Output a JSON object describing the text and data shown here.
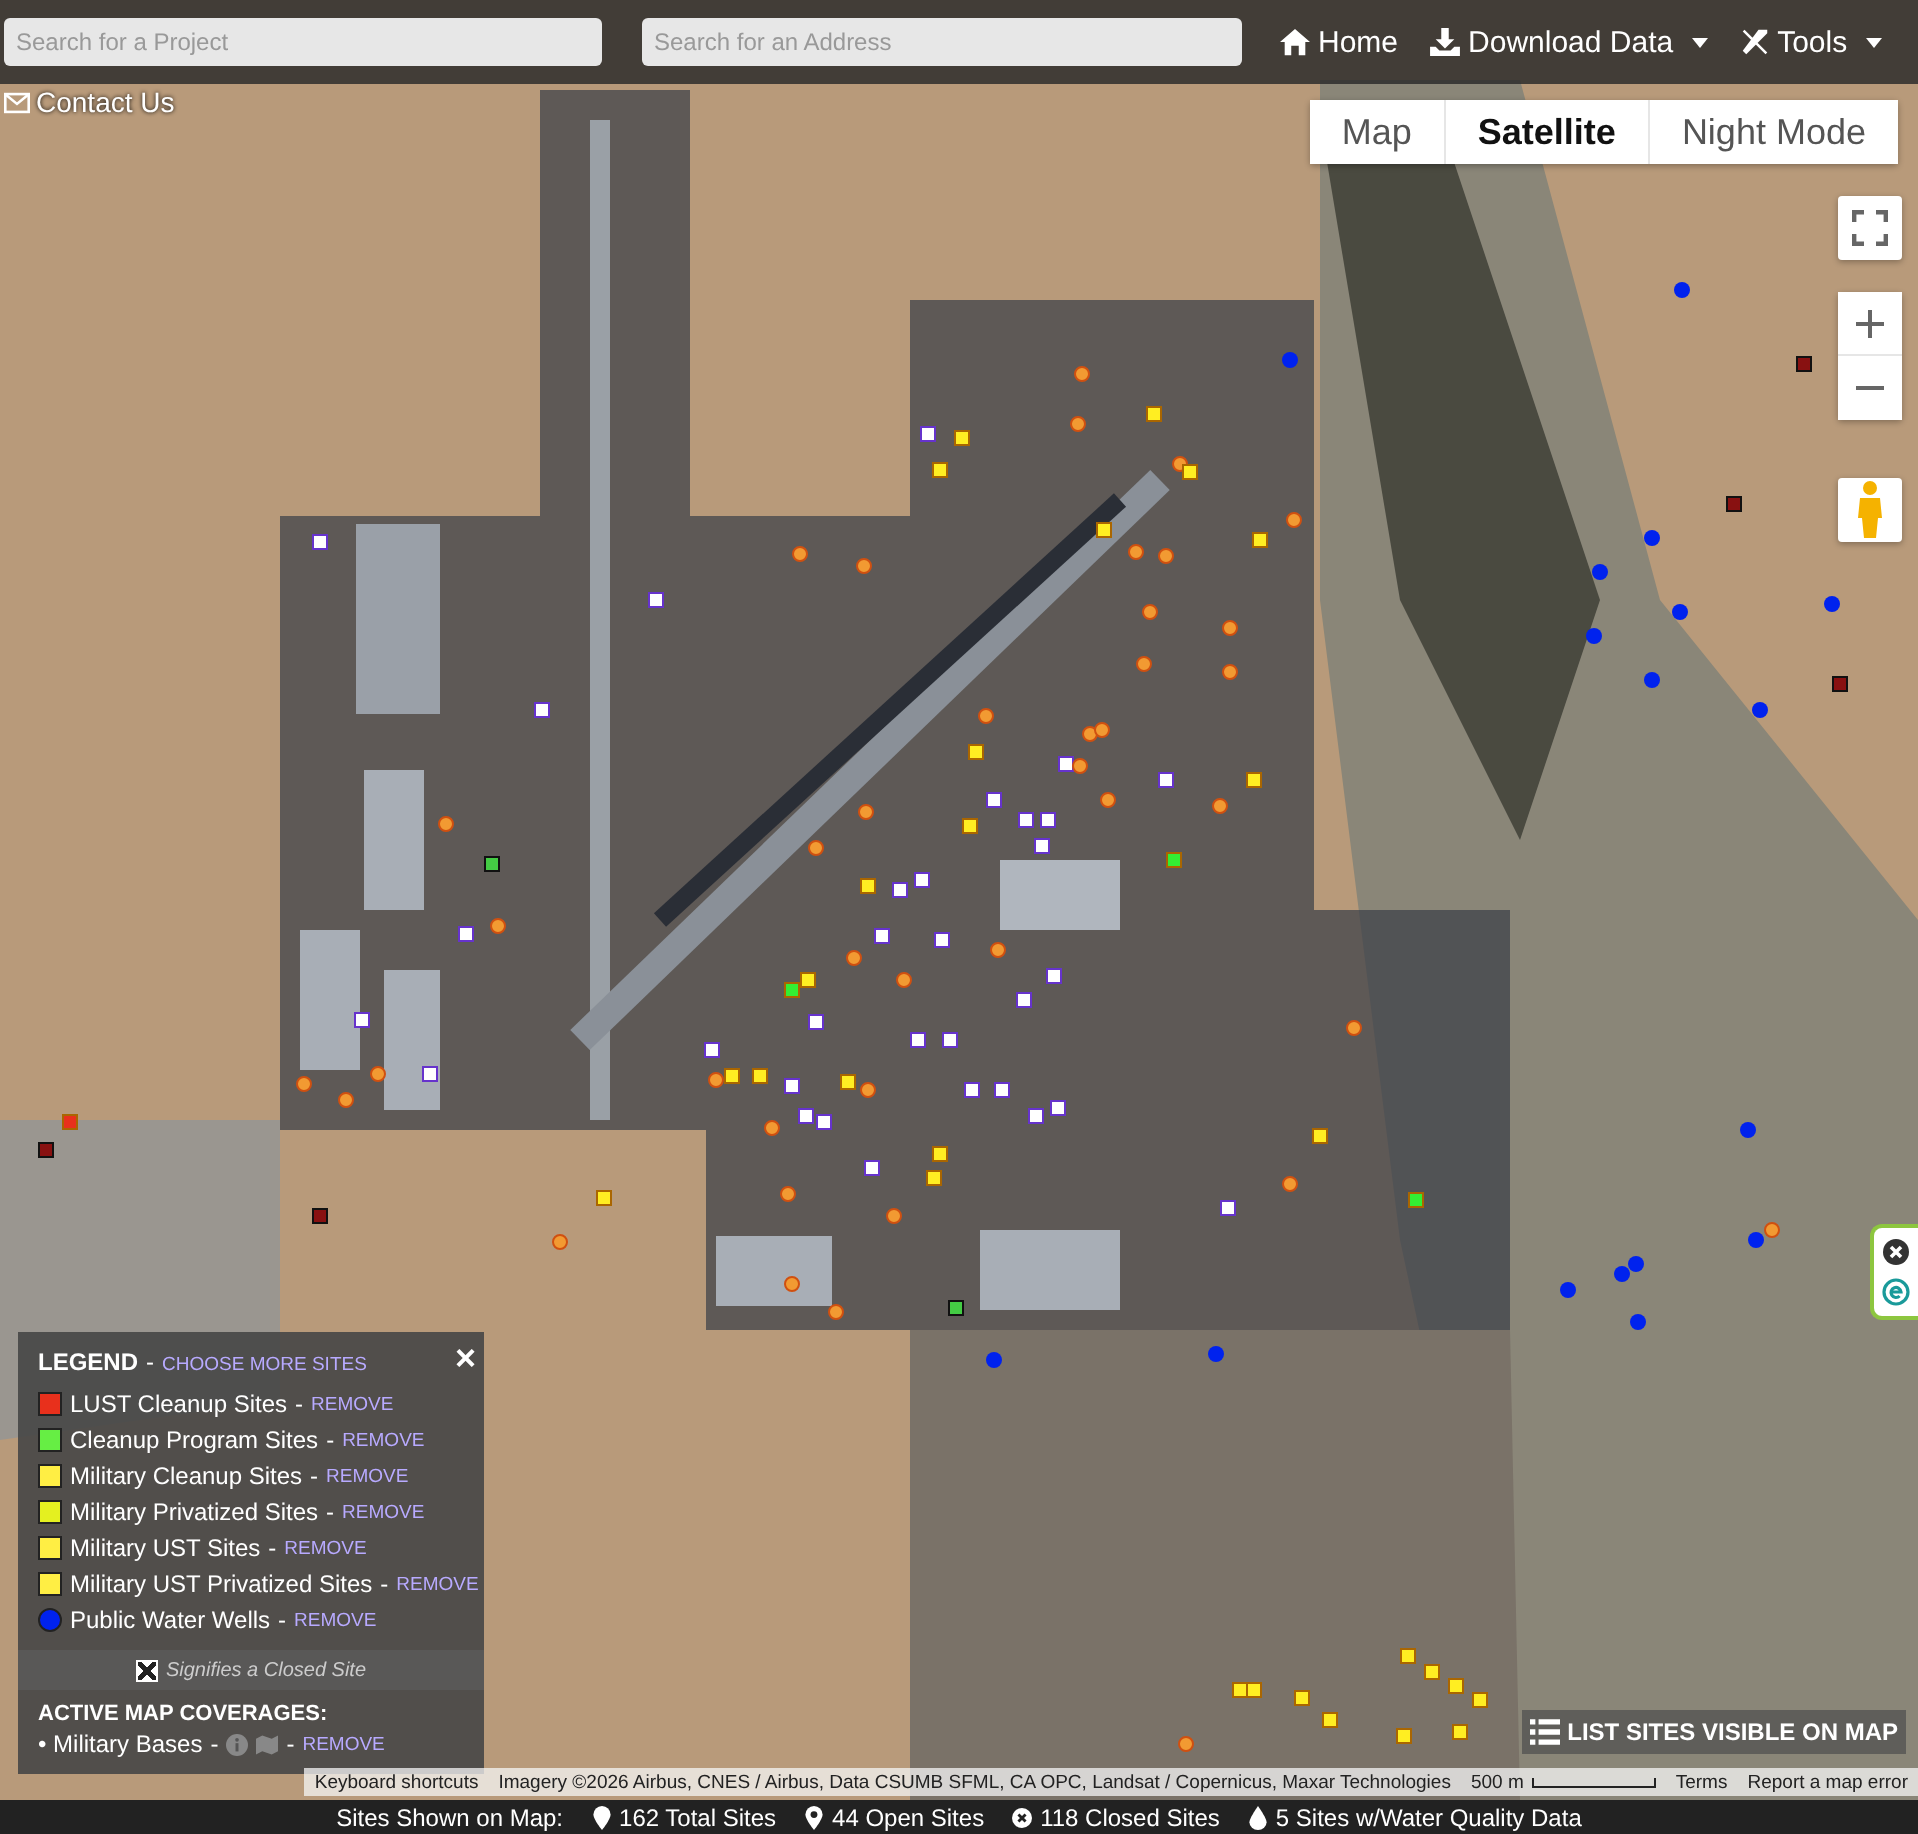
{
  "header": {
    "project_search": {
      "placeholder": "Search for a Project"
    },
    "address_search": {
      "placeholder": "Search for an Address"
    },
    "nav": [
      {
        "label": "Home",
        "kind": "home",
        "dropdown": false
      },
      {
        "label": "Download Data",
        "kind": "download",
        "dropdown": true
      },
      {
        "label": "Tools",
        "kind": "tools",
        "dropdown": true
      }
    ],
    "contact": "Contact Us"
  },
  "map_types": [
    {
      "label": "Map",
      "selected": false
    },
    {
      "label": "Satellite",
      "selected": true
    },
    {
      "label": "Night Mode",
      "selected": false
    }
  ],
  "legend": {
    "title": "LEGEND",
    "separator": "-",
    "choose_link": "CHOOSE MORE SITES",
    "close": "×",
    "items": [
      {
        "label": "LUST Cleanup Sites",
        "kind": "square",
        "color": "#e8301c",
        "remove": "REMOVE"
      },
      {
        "label": "Cleanup Program Sites",
        "kind": "square",
        "color": "#66ee44",
        "remove": "REMOVE"
      },
      {
        "label": "Military Cleanup Sites",
        "kind": "square",
        "color": "#ffee44",
        "remove": "REMOVE"
      },
      {
        "label": "Military Privatized Sites",
        "kind": "square",
        "color": "#e4f020",
        "remove": "REMOVE"
      },
      {
        "label": "Military UST Sites",
        "kind": "square",
        "color": "#ffee44",
        "remove": "REMOVE"
      },
      {
        "label": "Military UST Privatized Sites",
        "kind": "square",
        "color": "#ffee44",
        "remove": "REMOVE"
      },
      {
        "label": "Public Water Wells",
        "kind": "circle",
        "color": "#0022ee",
        "remove": "REMOVE"
      }
    ],
    "closed_note": "Signifies a Closed Site",
    "coverages_title": "ACTIVE MAP COVERAGES:",
    "coverages": [
      {
        "label": "• Military Bases",
        "separator": "-",
        "remove": "REMOVE"
      }
    ]
  },
  "list_button": "LIST SITES VISIBLE ON MAP",
  "attribution": {
    "keyboard": "Keyboard shortcuts",
    "imagery": "Imagery ©2026 Airbus, CNES / Airbus, Data CSUMB SFML, CA OPC, Landsat / Copernicus, Maxar Technologies",
    "scale": "500 m",
    "terms": "Terms",
    "report": "Report a map error"
  },
  "status_bar": {
    "label": "Sites Shown on Map:",
    "stats": [
      {
        "kind": "pin",
        "text": "162 Total Sites"
      },
      {
        "kind": "pin-outline",
        "text": "44 Open Sites"
      },
      {
        "kind": "closed",
        "text": "118 Closed Sites"
      },
      {
        "kind": "drop",
        "text": "5 Sites w/Water Quality Data"
      }
    ]
  }
}
